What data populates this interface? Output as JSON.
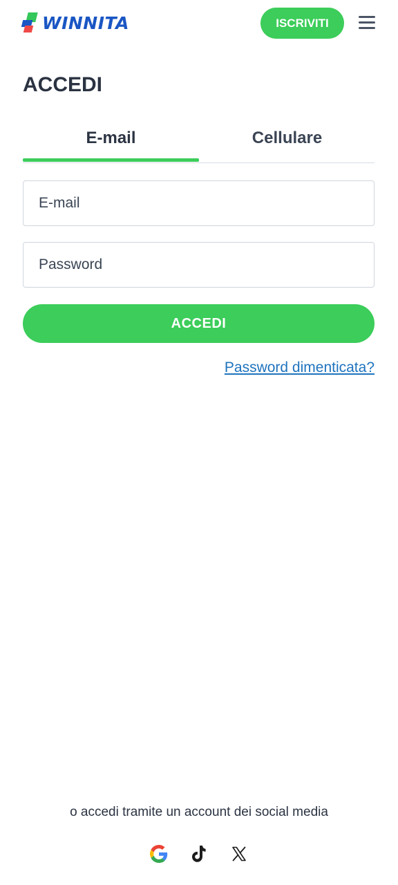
{
  "header": {
    "logo_text": "WINNITA",
    "signup_label": "ISCRIVITI",
    "brand_colors": {
      "green": "#3ccd5a",
      "blue": "#1a56c4",
      "red": "#f04848"
    }
  },
  "login": {
    "title": "ACCEDI",
    "tabs": [
      {
        "label": "E-mail",
        "active": true
      },
      {
        "label": "Cellulare",
        "active": false
      }
    ],
    "email_placeholder": "E-mail",
    "password_placeholder": "Password",
    "submit_label": "ACCEDI",
    "forgot_label": "Password dimenticata?"
  },
  "social": {
    "text": "o accedi tramite un account dei social media",
    "icons": [
      "google-icon",
      "tiktok-icon",
      "x-icon"
    ]
  }
}
